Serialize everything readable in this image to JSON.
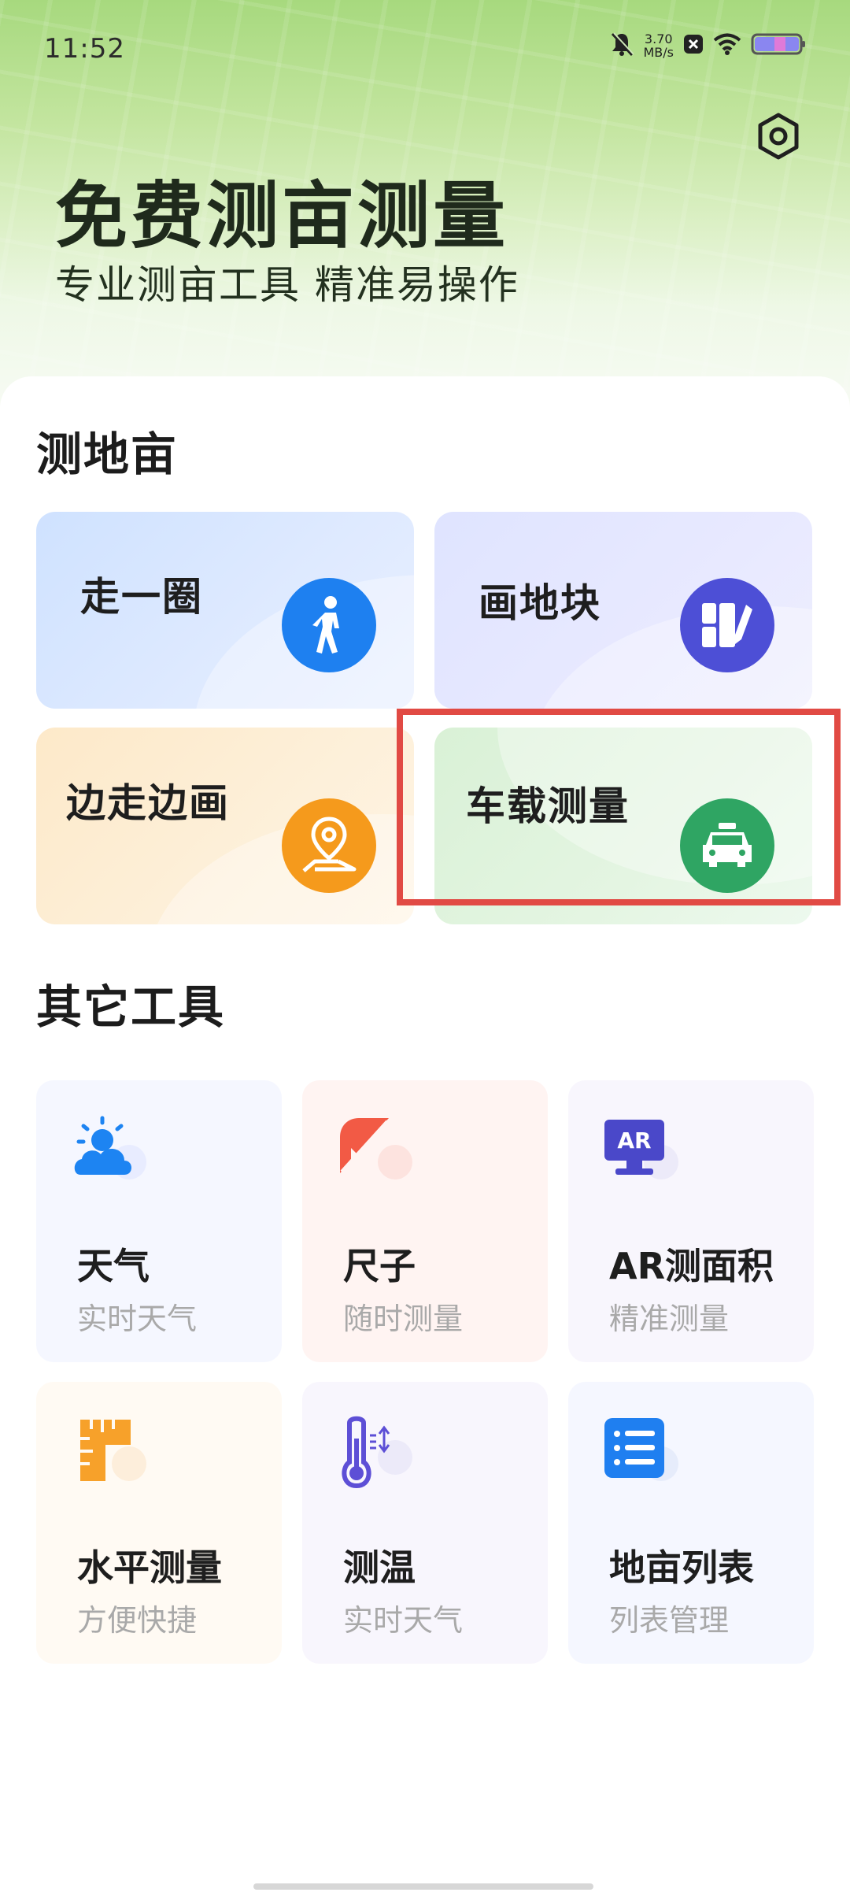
{
  "status_bar": {
    "time": "11:52",
    "net_speed_value": "3.70",
    "net_speed_unit": "MB/s",
    "icons": [
      "mute-bell-icon",
      "close-notification-icon",
      "wifi-icon",
      "battery-icon"
    ]
  },
  "header": {
    "title": "免费测亩测量",
    "subtitle": "专业测亩工具 精准易操作",
    "settings_icon": "gear-icon"
  },
  "measure_section": {
    "title": "测地亩",
    "cards": [
      {
        "label": "走一圈",
        "icon": "walking-person-icon",
        "color": "#1e80f0"
      },
      {
        "label": "画地块",
        "icon": "draw-plot-icon",
        "color": "#4d4fd6"
      },
      {
        "label": "边走边画",
        "icon": "map-pin-route-icon",
        "color": "#f59a1c"
      },
      {
        "label": "车载测量",
        "icon": "car-icon",
        "color": "#2fa563"
      }
    ],
    "highlighted": "车载测量"
  },
  "tools_section": {
    "title": "其它工具",
    "tools": [
      {
        "name": "天气",
        "desc": "实时天气",
        "icon": "weather-sun-cloud-icon"
      },
      {
        "name": "尺子",
        "desc": "随时测量",
        "icon": "ruler-triangle-icon"
      },
      {
        "name": "AR测面积",
        "desc": "精准测量",
        "icon": "ar-monitor-icon"
      },
      {
        "name": "水平测量",
        "desc": "方便快捷",
        "icon": "level-ruler-icon"
      },
      {
        "name": "测温",
        "desc": "实时天气",
        "icon": "thermometer-icon"
      },
      {
        "name": "地亩列表",
        "desc": "列表管理",
        "icon": "list-icon"
      }
    ]
  }
}
